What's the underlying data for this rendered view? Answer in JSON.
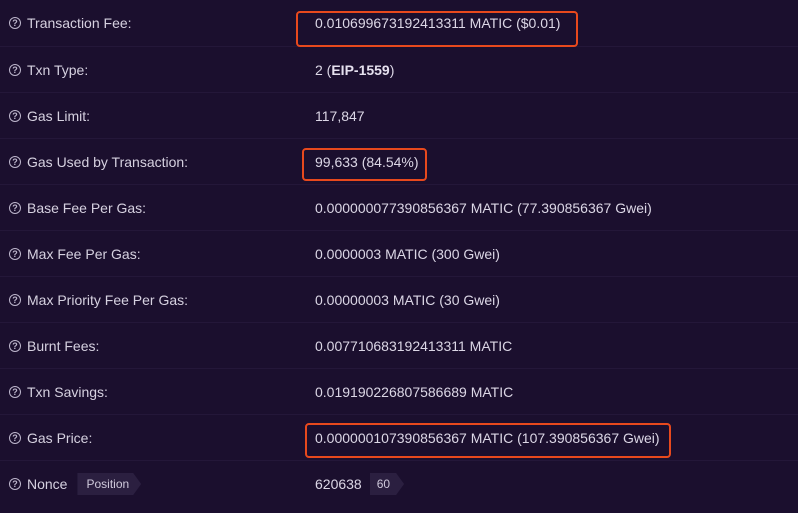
{
  "rows": [
    {
      "label": "Transaction Fee:",
      "value": "0.010699673192413311 MATIC ($0.01)"
    },
    {
      "label": "Txn Type:",
      "value_prefix": "2 (",
      "value_bold": "EIP-1559",
      "value_suffix": ")"
    },
    {
      "label": "Gas Limit:",
      "value": "117,847"
    },
    {
      "label": "Gas Used by Transaction:",
      "value": "99,633 (84.54%)"
    },
    {
      "label": "Base Fee Per Gas:",
      "value": "0.000000077390856367 MATIC (77.390856367 Gwei)"
    },
    {
      "label": "Max Fee Per Gas:",
      "value": "0.0000003 MATIC (300 Gwei)"
    },
    {
      "label": "Max Priority Fee Per Gas:",
      "value": "0.00000003 MATIC (30 Gwei)"
    },
    {
      "label": "Burnt Fees:",
      "value": "0.007710683192413311 MATIC"
    },
    {
      "label": "Txn Savings:",
      "value": "0.019190226807586689 MATIC"
    },
    {
      "label": "Gas Price:",
      "value": "0.000000107390856367 MATIC (107.390856367 Gwei)"
    },
    {
      "label": "Nonce",
      "value": "620638",
      "label_tag": "Position",
      "value_tag": "60"
    }
  ],
  "icons": {
    "help": "question-circle-icon"
  },
  "colors": {
    "background": "#1b0f2e",
    "highlight": "#e8491d"
  }
}
